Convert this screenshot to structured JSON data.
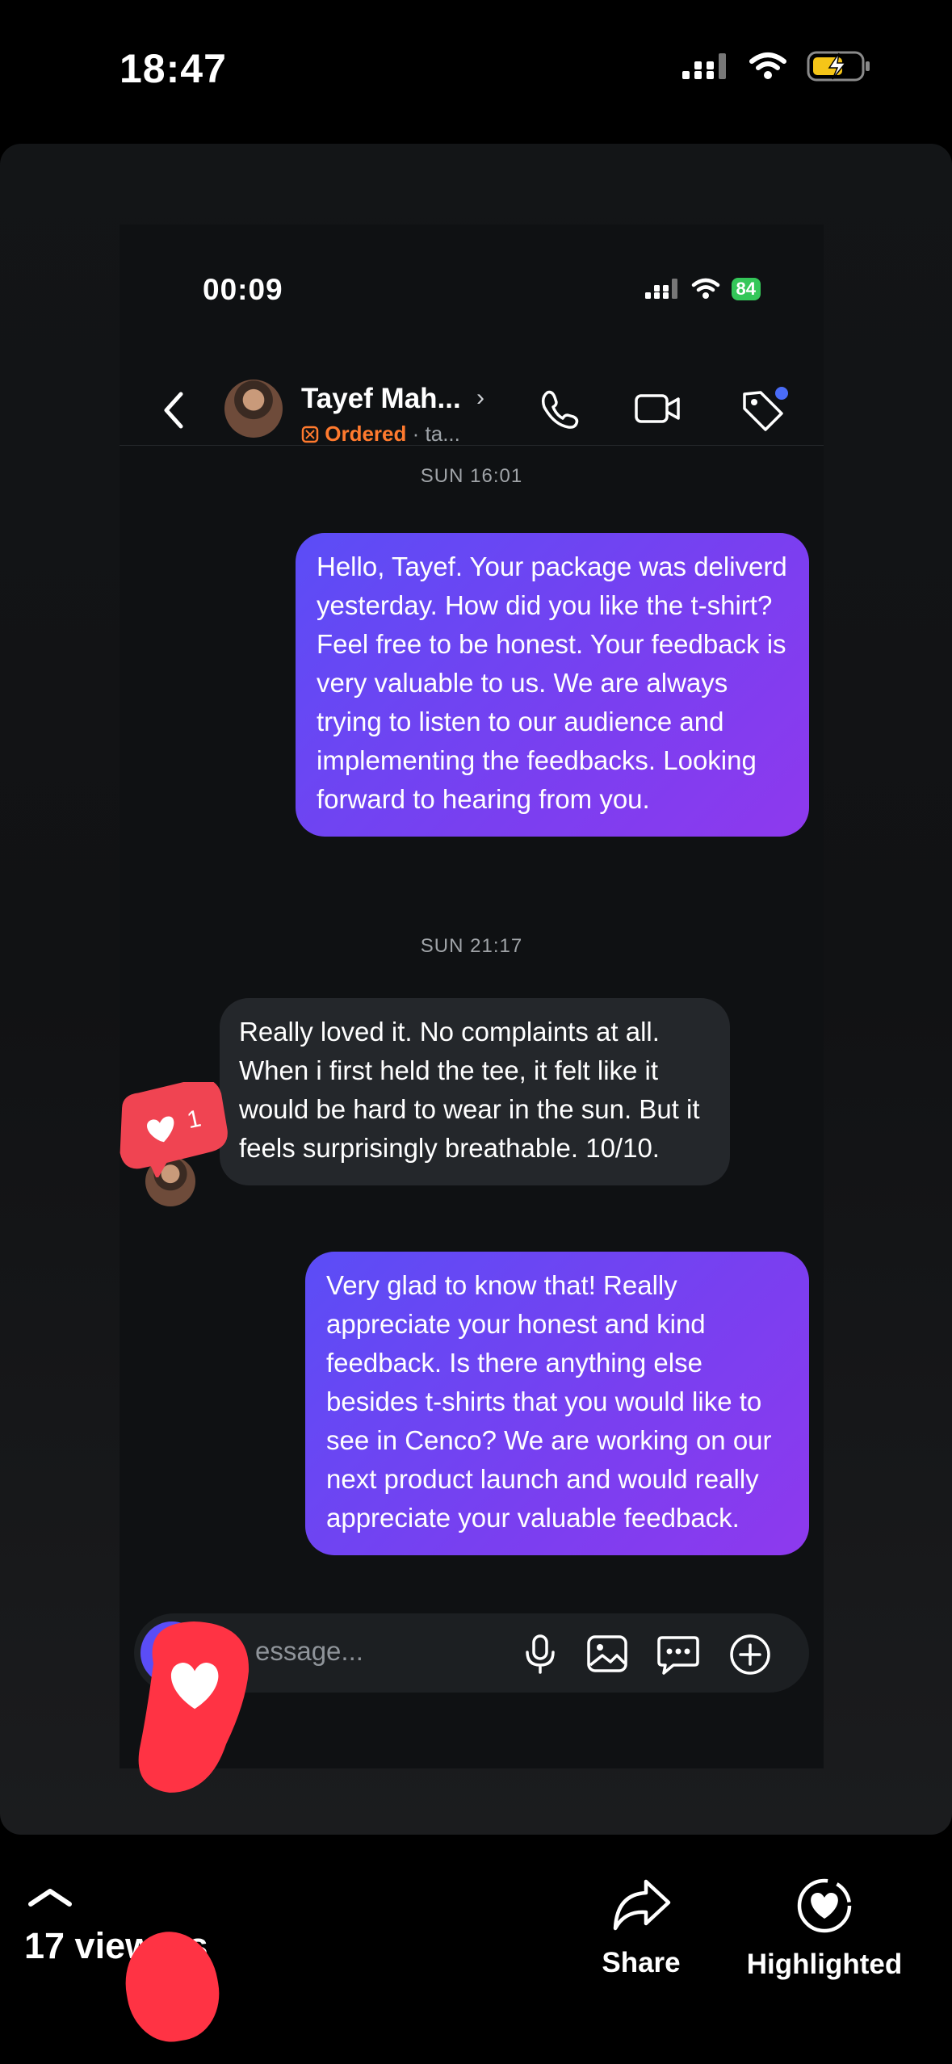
{
  "os_status": {
    "time": "18:47"
  },
  "inner_status": {
    "time": "00:09",
    "battery": "84"
  },
  "chat": {
    "contact_name": "Tayef Mah...",
    "status": "Ordered",
    "status_extra": "· ta...",
    "timestamp_1": "SUN 16:01",
    "timestamp_2": "SUN 21:17",
    "messages": [
      {
        "from": "me",
        "text": "Hello, Tayef. Your package was deliverd yesterday. How did you like the t-shirt? Feel free to be honest. Your feedback is very valuable to us. We are always trying to listen to our audience and implementing the feedbacks. Looking forward to hearing from you."
      },
      {
        "from": "them",
        "text": "Really loved it. No complaints at all. When i first held the tee, it felt like it would be hard to wear in the sun. But it feels surprisingly breathable. 10/10."
      },
      {
        "from": "me",
        "text": "Very glad to know that! Really appreciate your honest and kind feedback. Is there anything else besides t-shirts that you would like to see in Cenco? We are working on our next product launch and would really appreciate your valuable feedback."
      }
    ],
    "composer_placeholder": "essage...",
    "reaction_count": "1"
  },
  "bottom_bar": {
    "viewers": "17 viewers",
    "share_label": "Share",
    "highlighted_label": "Highlighted"
  },
  "colors": {
    "accent_purple": "#6a45f2",
    "ordered_orange": "#ff7a2e",
    "reaction_red": "#ff3344"
  }
}
